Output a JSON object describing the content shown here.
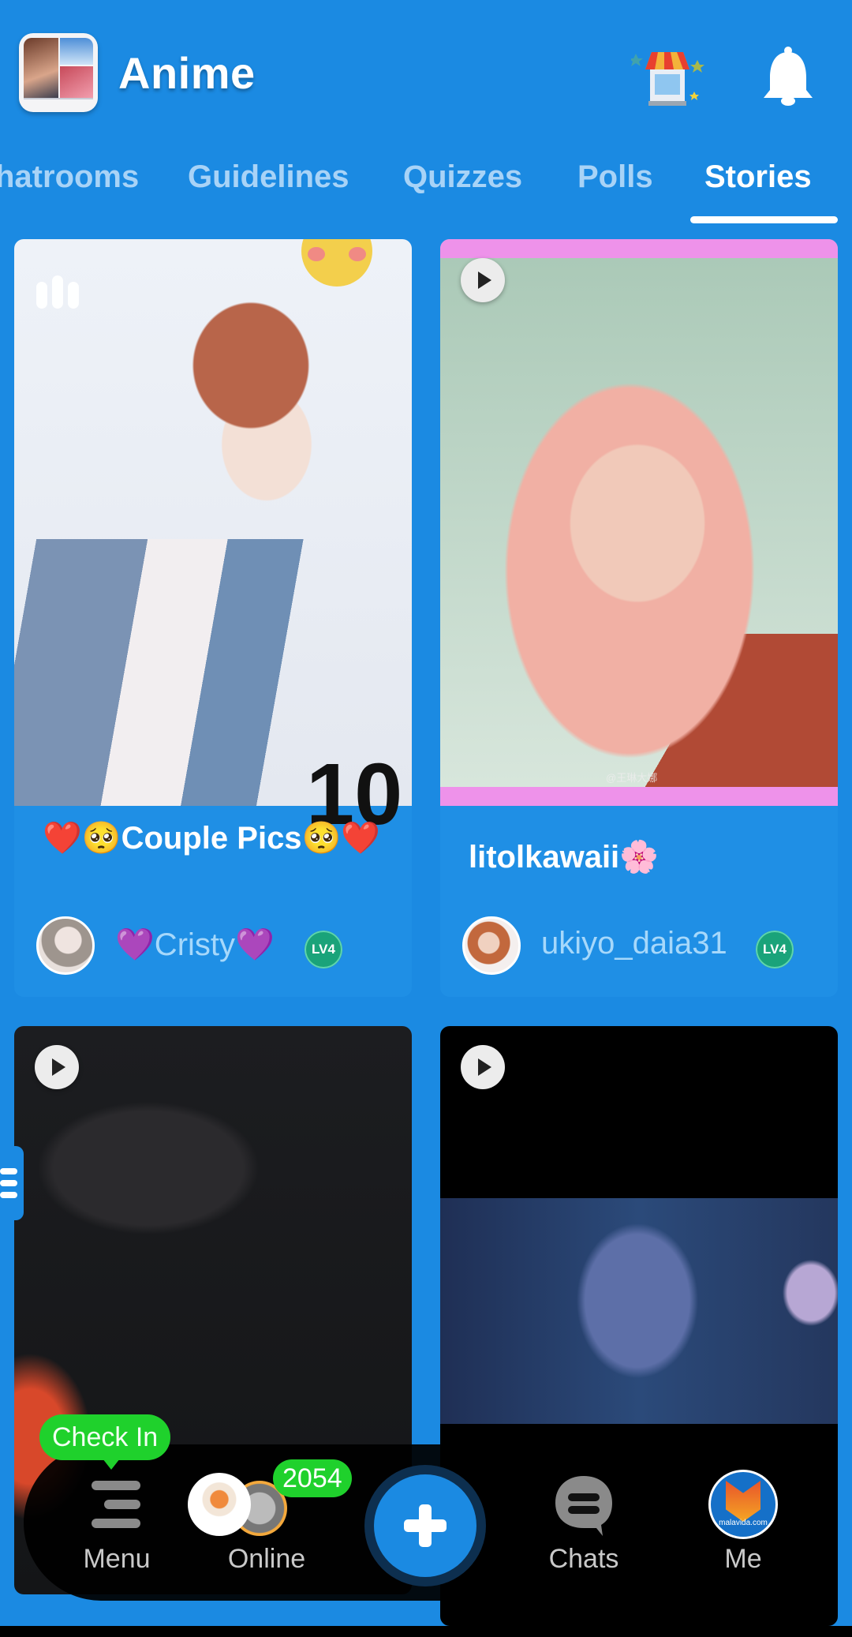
{
  "header": {
    "title": "Anime",
    "icons": [
      "app-logo",
      "store-icon",
      "bell-icon"
    ]
  },
  "tabs": [
    {
      "label": "Chatrooms",
      "visible_label": "hatrooms",
      "active": false
    },
    {
      "label": "Guidelines",
      "active": false
    },
    {
      "label": "Quizzes",
      "active": false
    },
    {
      "label": "Polls",
      "active": false
    },
    {
      "label": "Stories",
      "active": true
    }
  ],
  "stories": [
    {
      "title": "❤️🥺Couple Pics🥺❤️",
      "author": "💜Cristy💜",
      "level": "LV4",
      "media_icon": "audio-bars-icon"
    },
    {
      "title": "litolkawaii🌸",
      "author": "ukiyo_daia31",
      "level": "LV4",
      "media_icon": "play-icon",
      "watermark": "@王琳大娜"
    },
    {
      "media_icon": "play-icon"
    },
    {
      "media_icon": "play-icon"
    }
  ],
  "bottom_nav": {
    "checkin_label": "Check In",
    "online_count": "2054",
    "items": [
      {
        "label": "Menu",
        "icon": "menu-icon"
      },
      {
        "label": "Online",
        "icon": "online-avatars"
      },
      {
        "label": "",
        "icon": "plus-icon"
      },
      {
        "label": "Chats",
        "icon": "chat-bubble-icon"
      },
      {
        "label": "Me",
        "icon": "user-avatar"
      }
    ],
    "me_avatar_text": "malavida.com"
  },
  "colors": {
    "background": "#1b8ae2",
    "card": "#1f8fe5",
    "tab_inactive": "#a8d3f7",
    "author_name": "#a6d8fb",
    "badge_green": "#1fd12c",
    "level_badge": "#1aa37a"
  }
}
